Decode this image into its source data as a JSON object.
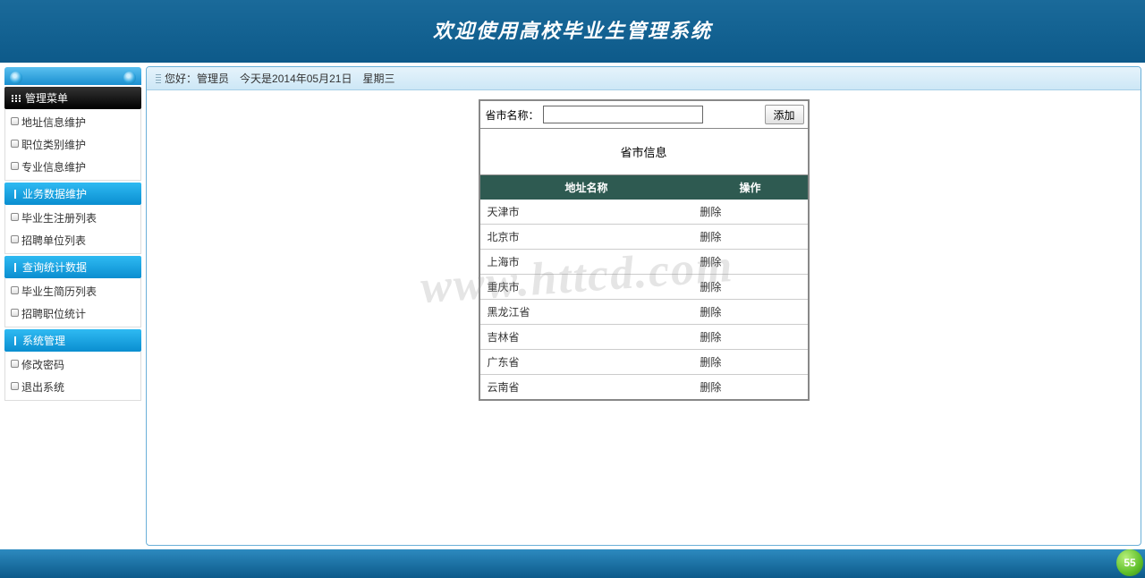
{
  "header": {
    "title": "欢迎使用高校毕业生管理系统"
  },
  "topbar": {
    "greeting": "您好：",
    "role": "管理员",
    "date_prefix": "今天是",
    "date": "2014年05月21日",
    "weekday": "星期三"
  },
  "sidebar": {
    "root": "管理菜单",
    "group0_items": [
      "地址信息维护",
      "职位类别维护",
      "专业信息维护"
    ],
    "group1": {
      "label": "业务数据维护",
      "items": [
        "毕业生注册列表",
        "招聘单位列表"
      ]
    },
    "group2": {
      "label": "查询统计数据",
      "items": [
        "毕业生简历列表",
        "招聘职位统计"
      ]
    },
    "group3": {
      "label": "系统管理",
      "items": [
        "修改密码",
        "退出系统"
      ]
    }
  },
  "form": {
    "label": "省市名称：",
    "value": "",
    "add_button": "添加"
  },
  "panel": {
    "title": "省市信息"
  },
  "table": {
    "headers": [
      "地址名称",
      "操作"
    ],
    "rows": [
      {
        "name": "天津市",
        "op": "删除"
      },
      {
        "name": "北京市",
        "op": "删除"
      },
      {
        "name": "上海市",
        "op": "删除"
      },
      {
        "name": "重庆市",
        "op": "删除"
      },
      {
        "name": "黑龙江省",
        "op": "删除"
      },
      {
        "name": "吉林省",
        "op": "删除"
      },
      {
        "name": "广东省",
        "op": "删除"
      },
      {
        "name": "云南省",
        "op": "删除"
      }
    ]
  },
  "watermark": "www.httcd.com",
  "badge": "55"
}
